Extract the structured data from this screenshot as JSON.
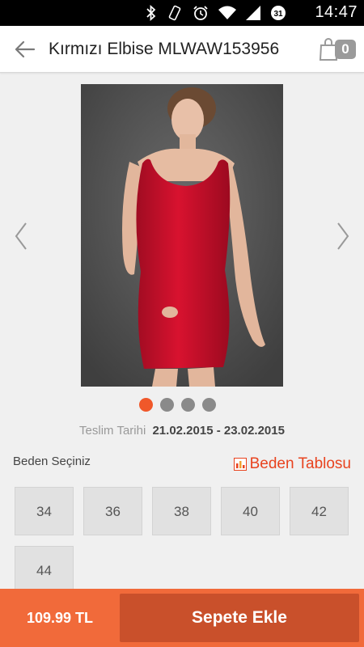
{
  "status_bar": {
    "time": "14:47",
    "icons": [
      "bluetooth-icon",
      "vibrate-icon",
      "alarm-icon",
      "wifi-icon",
      "signal-icon",
      "battery-icon"
    ],
    "battery_level": "31"
  },
  "header": {
    "title": "Kırmızı Elbise MLWAW153956",
    "cart_count": "0"
  },
  "gallery": {
    "image_alt": "red dress model photo",
    "total_images": 4,
    "active_index": 0
  },
  "delivery": {
    "label": "Teslim Tarihi",
    "date_range": "21.02.2015 - 23.02.2015"
  },
  "sizes": {
    "label": "Beden Seçiniz",
    "chart_link": "Beden Tablosu",
    "options": [
      "34",
      "36",
      "38",
      "40",
      "42",
      "44"
    ]
  },
  "footer": {
    "price": "109.99 TL",
    "add_to_cart": "Sepete Ekle"
  },
  "colors": {
    "accent": "#f16a3a",
    "accent_dark": "#c9502b",
    "link": "#e8431f",
    "dress": "#c8102e"
  }
}
